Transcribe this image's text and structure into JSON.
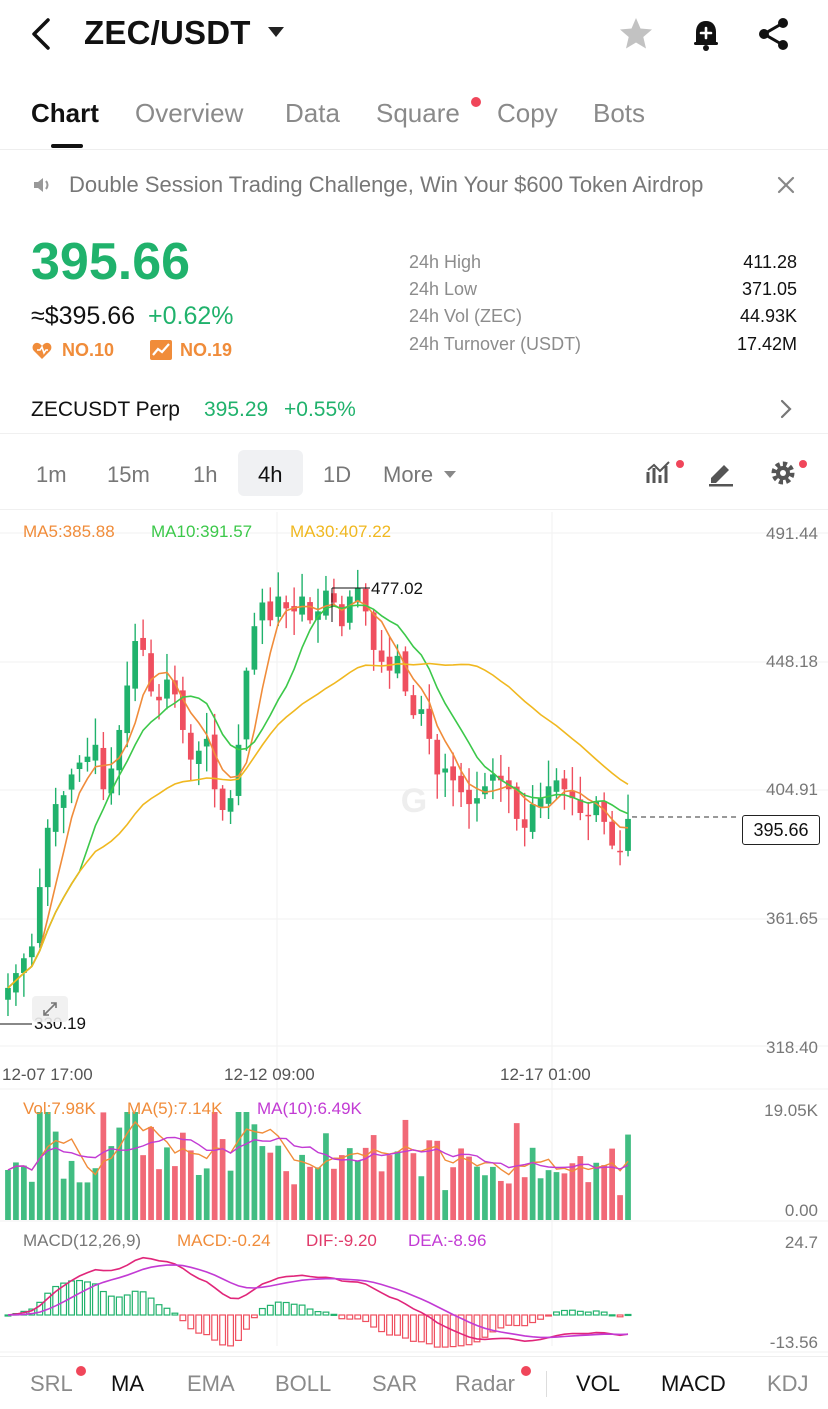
{
  "header": {
    "pair": "ZEC/USDT"
  },
  "tabs": [
    {
      "label": "Chart"
    },
    {
      "label": "Overview"
    },
    {
      "label": "Data"
    },
    {
      "label": "Square"
    },
    {
      "label": "Copy"
    },
    {
      "label": "Bots"
    }
  ],
  "announcement": {
    "text": "Double Session Trading Challenge, Win Your $600 Token Airdrop"
  },
  "price": {
    "last": "395.66",
    "usd": "≈$395.66",
    "change": "+0.62%",
    "rank1": "NO.10",
    "rank2": "NO.19"
  },
  "stats": [
    {
      "label": "24h High",
      "value": "411.28"
    },
    {
      "label": "24h Low",
      "value": "371.05"
    },
    {
      "label": "24h Vol (ZEC)",
      "value": "44.93K"
    },
    {
      "label": "24h Turnover (USDT)",
      "value": "17.42M"
    }
  ],
  "perp": {
    "name": "ZECUSDT Perp",
    "price": "395.29",
    "change": "+0.55%"
  },
  "intervals": [
    "1m",
    "15m",
    "1h",
    "4h",
    "1D",
    "More"
  ],
  "colors": {
    "up": "#20b26c",
    "down": "#ef4f5f",
    "ma5": "#f08c3a",
    "ma10": "#3cc84a",
    "ma30": "#f0b820",
    "vol_ma10": "#c23bd4"
  },
  "main_chart": {
    "ma5": "MA5:385.88",
    "ma10": "MA10:391.57",
    "ma30": "MA30:407.22",
    "axis": [
      "491.44",
      "448.18",
      "404.91",
      "361.65",
      "318.40"
    ],
    "high_mark": "477.02",
    "low_mark": "330.19",
    "current_price": "395.66",
    "times": [
      "12-07 17:00",
      "12-12 09:00",
      "12-17 01:00"
    ]
  },
  "volume": {
    "vol": "Vol:7.98K",
    "ma5": "MA(5):7.14K",
    "ma10": "MA(10):6.49K",
    "axis_top": "19.05K",
    "axis_bottom": "0.00"
  },
  "macd": {
    "title": "MACD(12,26,9)",
    "macd": "MACD:-0.24",
    "dif": "DIF:-9.20",
    "dea": "DEA:-8.96",
    "axis_top": "24.7",
    "axis_bottom": "-13.56"
  },
  "indicators": [
    "SRL",
    "MA",
    "EMA",
    "BOLL",
    "SAR",
    "Radar",
    "VOL",
    "MACD",
    "KDJ"
  ],
  "chart_data": {
    "type": "candlestick",
    "axis_range": [
      318.4,
      491.44
    ],
    "closes": [
      338,
      343,
      348,
      352,
      372,
      392,
      400,
      403,
      410,
      414,
      416,
      420,
      405,
      412,
      425,
      440,
      455,
      452,
      438,
      435,
      442,
      437,
      425,
      415,
      418,
      422,
      405,
      398,
      402,
      420,
      445,
      460,
      468,
      462,
      470,
      466,
      465,
      470,
      462,
      465,
      472,
      468,
      460,
      470,
      473,
      465,
      452,
      448,
      445,
      450,
      438,
      430,
      432,
      422,
      410,
      412,
      408,
      404,
      400,
      402,
      406,
      410,
      408,
      405,
      395,
      392,
      400,
      402,
      406,
      408,
      405,
      402,
      397,
      396,
      401,
      394,
      386,
      384,
      395
    ]
  }
}
